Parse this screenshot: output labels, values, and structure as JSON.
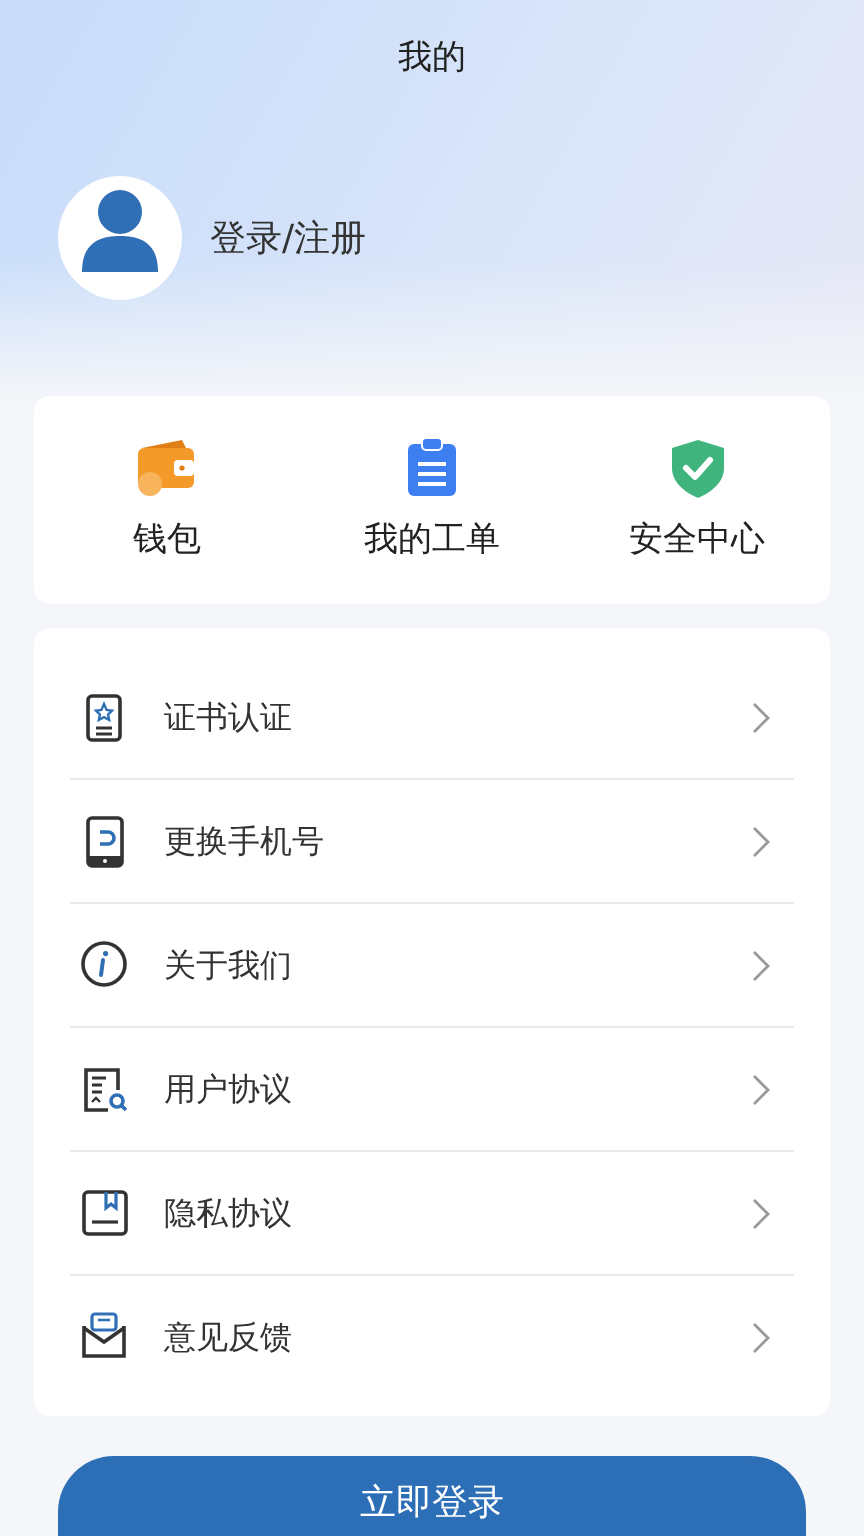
{
  "header": {
    "title": "我的"
  },
  "profile": {
    "label": "登录/注册"
  },
  "quick_actions": [
    {
      "kind": "wallet",
      "label": "钱包"
    },
    {
      "kind": "clipboard",
      "label": "我的工单"
    },
    {
      "kind": "shield",
      "label": "安全中心"
    }
  ],
  "menu": [
    {
      "kind": "certificate",
      "label": "证书认证"
    },
    {
      "kind": "phone",
      "label": "更换手机号"
    },
    {
      "kind": "info",
      "label": "关于我们"
    },
    {
      "kind": "document",
      "label": "用户协议"
    },
    {
      "kind": "bookmark",
      "label": "隐私协议"
    },
    {
      "kind": "mail",
      "label": "意见反馈"
    }
  ],
  "login_button": {
    "label": "立即登录"
  }
}
